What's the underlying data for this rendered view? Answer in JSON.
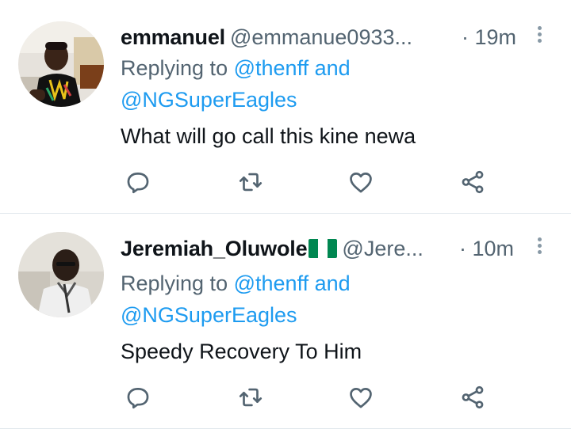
{
  "colors": {
    "link": "#1d9bf0",
    "secondary_text": "#536471",
    "primary_text": "#0f1419",
    "divider": "#e1e8ed",
    "flag_green": "#008751",
    "flag_white": "#ffffff"
  },
  "tweets": [
    {
      "name": "emmanuel",
      "handle": "@emmanue0933...",
      "time": "· 19m",
      "replying_prefix": "Replying to",
      "mention1": "@thenff",
      "conjunction": "and",
      "mention2": "@NGSuperEagles",
      "text": "What will go call this kine newa",
      "icons": [
        "reply-icon",
        "retweet-icon",
        "like-icon",
        "share-icon",
        "more-icon"
      ]
    },
    {
      "name": "Jeremiah_Oluwole",
      "name_emoji": "nigeria-flag-icon",
      "handle": "@Jere...",
      "time": "· 10m",
      "replying_prefix": "Replying to",
      "mention1": "@thenff",
      "conjunction": "and",
      "mention2": "@NGSuperEagles",
      "text": "Speedy Recovery To Him",
      "icons": [
        "reply-icon",
        "retweet-icon",
        "like-icon",
        "share-icon",
        "more-icon"
      ]
    }
  ]
}
